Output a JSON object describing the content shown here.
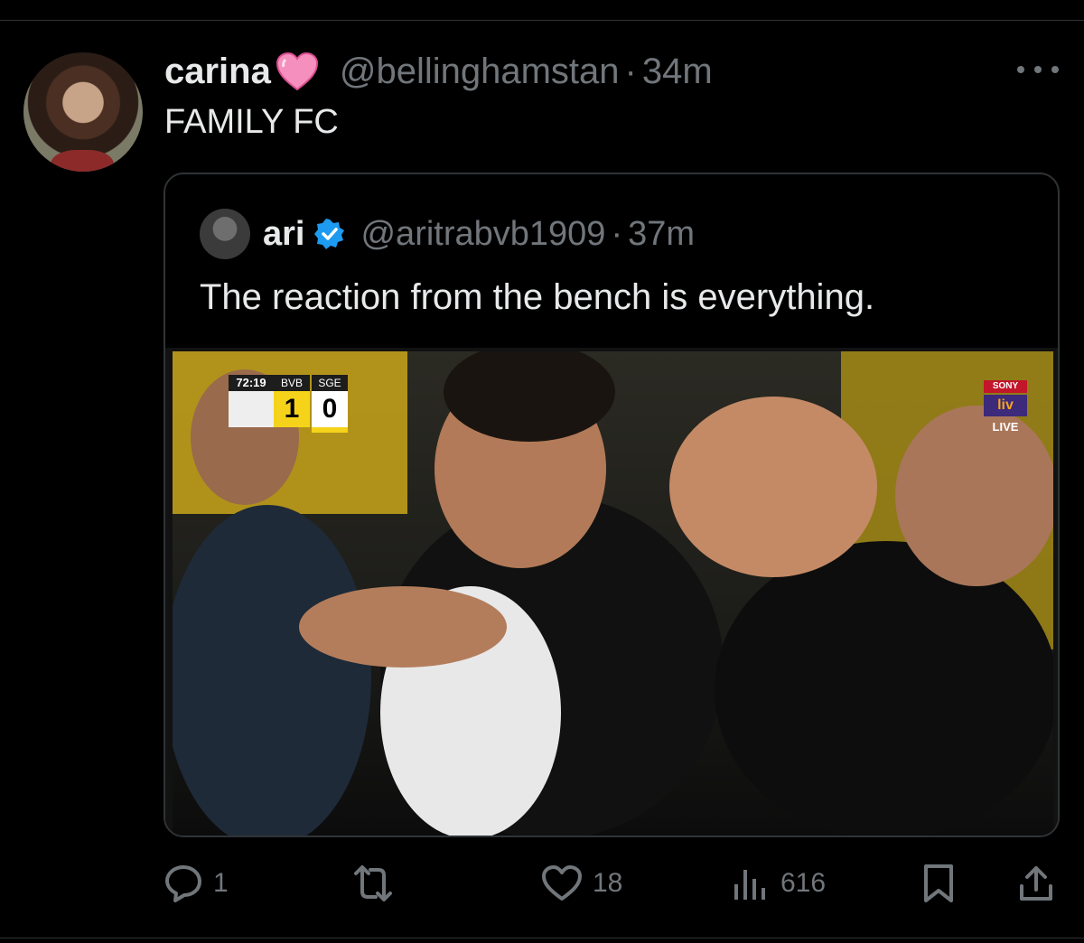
{
  "tweet": {
    "author_name": "carina",
    "handle": "@bellinghamstan",
    "separator": "·",
    "time": "34m",
    "text": "FAMILY FC",
    "avatar_icon": "profile-photo",
    "heart_emoji": "pink-heart-icon"
  },
  "quoted_tweet": {
    "author_name": "ari",
    "handle": "@aritrabvb1909",
    "separator": "·",
    "time": "37m",
    "text": "The reaction from the bench is everything.",
    "verified": true,
    "media": {
      "scoreboard": {
        "clock": "72:19",
        "team1": "BVB",
        "team2": "SGE",
        "score1": "1",
        "score2": "0"
      },
      "broadcaster": {
        "brand": "SONY",
        "product": "liv",
        "status": "LIVE"
      }
    }
  },
  "actions": {
    "replies": "1",
    "retweets": "",
    "likes": "18",
    "views": "616"
  },
  "colors": {
    "background": "#000000",
    "text": "#e7e9ea",
    "muted": "#71767b",
    "border": "#2f3336",
    "verified": "#1d9bf0"
  }
}
